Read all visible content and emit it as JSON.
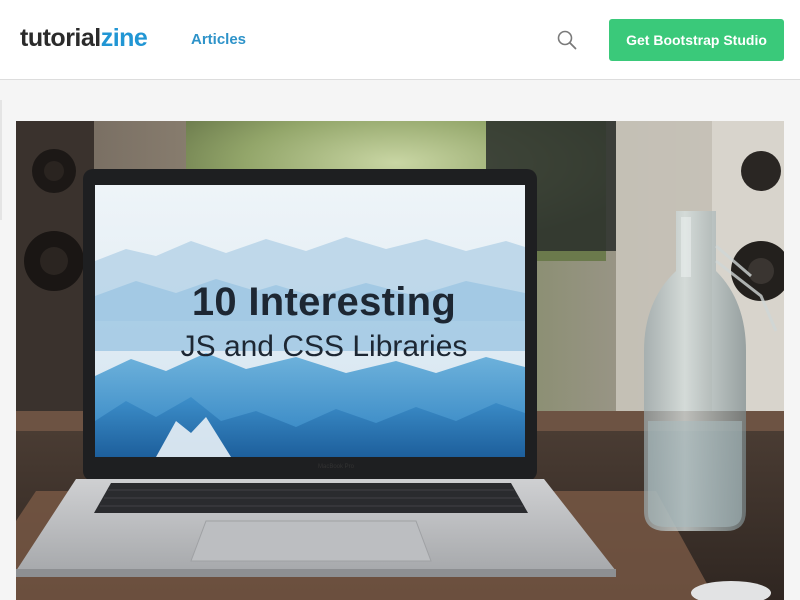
{
  "header": {
    "logo_part1": "tutorial",
    "logo_part2": "zine",
    "nav_articles": "Articles",
    "search_icon": "search-icon",
    "cta_label": "Get Bootstrap Studio"
  },
  "hero": {
    "screen_title": "10 Interesting",
    "screen_subtitle": "JS and CSS Libraries",
    "laptop_model": "MacBook Pro"
  },
  "colors": {
    "brand_accent": "#2196d4",
    "nav_link": "#2e93c9",
    "cta_background": "#3ac97a",
    "text_dark": "#2b2b2b"
  }
}
